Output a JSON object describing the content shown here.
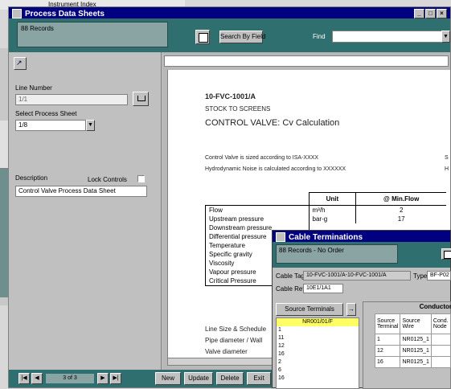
{
  "background_window": {
    "top_text": "Instrument Index"
  },
  "main_window": {
    "title": "Process Data Sheets",
    "record_count": "88 Records",
    "search_button_label": "Search By Field",
    "find_label": "Find",
    "find_value": "",
    "left_panel": {
      "line_number_label": "Line Number",
      "line_number_value": "1/1",
      "select_sheet_label": "Select Process Sheet",
      "select_sheet_value": "1/8",
      "description_label": "Description",
      "lock_controls_label": "Lock Controls",
      "description_value": "Control Valve Process Data Sheet"
    },
    "document": {
      "tag": "10-FVC-1001/A",
      "subtitle": "STOCK TO SCREENS",
      "heading": "CONTROL VALVE: Cv Calculation",
      "note1": "Control Valve is sized according to ISA-XXXX",
      "note1_right": "S",
      "note2": "Hydrodynamic Noise is calculated according to XXXXXX",
      "note2_right": "H",
      "table_headers": [
        "",
        "Unit",
        "@ Min.Flow"
      ],
      "rows": [
        {
          "label": "Flow",
          "unit": "m³/h",
          "value": "2"
        },
        {
          "label": "Upstream pressure",
          "unit": "bar-g",
          "value": "17"
        },
        {
          "label": "Downstream pressure",
          "unit": "",
          "value": ""
        },
        {
          "label": "Differential pressure",
          "unit": "",
          "value": ""
        },
        {
          "label": "Temperature",
          "unit": "",
          "value": ""
        },
        {
          "label": "Specific gravity",
          "unit": "",
          "value": ""
        },
        {
          "label": "Viscosity",
          "unit": "",
          "value": ""
        },
        {
          "label": "Vapour pressure",
          "unit": "",
          "value": ""
        },
        {
          "label": "Critical Pressure",
          "unit": "",
          "value": ""
        }
      ],
      "footer1": "Line Size & Schedule",
      "footer2": "Pipe diameter / Wall",
      "footer3": "Valve diameter"
    },
    "nav": {
      "record_position": "3 of 3",
      "new_label": "New",
      "update_label": "Update",
      "delete_label": "Delete",
      "extra_label": "Exit"
    }
  },
  "cable_window": {
    "title": "Cable Terminations",
    "record_info": "88 Records - No Order",
    "cable_tag_label": "Cable Tag",
    "cable_tag_value": "10-FVC-1001/A-10-FVC-1001/A",
    "type_label": "Type",
    "type_value": "BF-P02",
    "cable_ref_label": "Cable Ref",
    "cable_ref_value": "10E1/1A1",
    "source_terminals_label": "Source Terminals",
    "conductor_label": "Conductor",
    "highlight_item": "NR001/01/F",
    "terminal_list": [
      "1",
      "11",
      "12",
      "16",
      "2",
      "6",
      "16"
    ],
    "grid_headers": [
      "Source Terminal",
      "Source Wire",
      "Cond. Node"
    ],
    "grid_rows": [
      [
        "1",
        "NR0125_1",
        ""
      ],
      [
        "12",
        "NR0125_1",
        ""
      ],
      [
        "16",
        "NR0125_1",
        ""
      ]
    ]
  }
}
